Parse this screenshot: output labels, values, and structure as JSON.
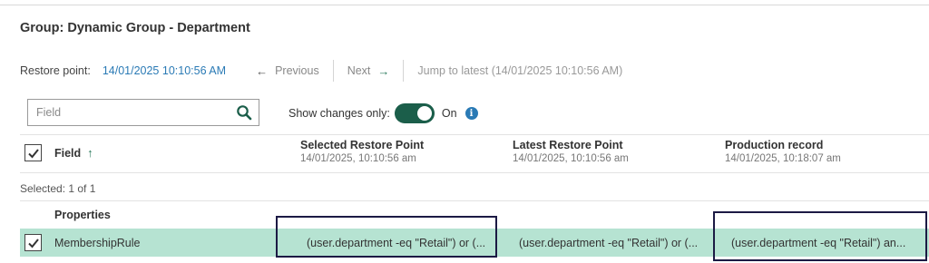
{
  "page": {
    "title": "Group: Dynamic Group - Department"
  },
  "restore_bar": {
    "label": "Restore point:",
    "date": "14/01/2025 10:10:56 AM",
    "previous_label": "Previous",
    "previous_arrow": "←",
    "next_label": "Next",
    "next_arrow": "→",
    "jump_label": "Jump to latest (14/01/2025 10:10:56 AM)"
  },
  "search": {
    "placeholder": "Field",
    "icon": "search-icon"
  },
  "changes_toggle": {
    "label": "Show changes only:",
    "state": "On",
    "enabled": true,
    "info_glyph": "i"
  },
  "table": {
    "header_checkbox_checked": true,
    "field_column": {
      "label": "Field",
      "sort_arrow": "↑"
    },
    "columns": [
      {
        "title": "Selected Restore Point",
        "date": "14/01/2025, 10:10:56 am"
      },
      {
        "title": "Latest Restore Point",
        "date": "14/01/2025, 10:10:56 am"
      },
      {
        "title": "Production record",
        "date": "14/01/2025, 10:18:07 am"
      }
    ],
    "selected_text": "Selected:  1 of 1",
    "group": "Properties",
    "rows": [
      {
        "checked": true,
        "field": "MembershipRule",
        "values": [
          "(user.department -eq \"Retail\") or (...",
          "(user.department -eq \"Retail\") or (...",
          "(user.department -eq \"Retail\") an..."
        ]
      }
    ]
  },
  "colors": {
    "accent_link": "#2a7ab5",
    "toggle_on": "#1b5e4a",
    "row_selected": "#b6e3d2",
    "annotation_box": "#1c1a44"
  }
}
